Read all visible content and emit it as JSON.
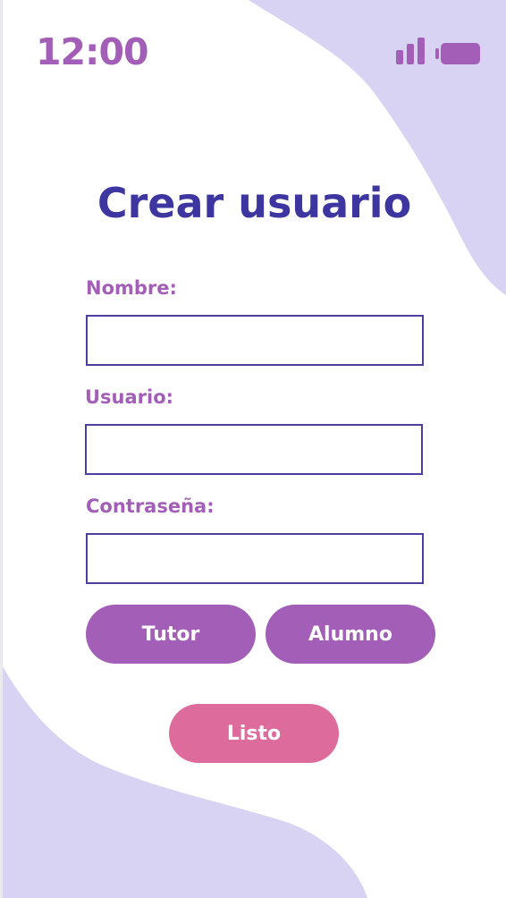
{
  "status_bar": {
    "time": "12:00",
    "signal_icon": "signal-bars-icon",
    "battery_icon": "battery-icon"
  },
  "title": "Crear usuario",
  "form": {
    "nombre": {
      "label": "Nombre:",
      "value": ""
    },
    "usuario": {
      "label": "Usuario:",
      "value": ""
    },
    "contrasena": {
      "label": "Contraseña:",
      "value": ""
    }
  },
  "role_buttons": {
    "tutor": "Tutor",
    "alumno": "Alumno"
  },
  "submit_button": "Listo",
  "colors": {
    "background": "#ffffff",
    "blob": "#d8d3f3",
    "accent_purple": "#a35fb7",
    "title_indigo": "#3e36a0",
    "field_border": "#4d3fa0",
    "submit_pink": "#dd6b9c"
  }
}
